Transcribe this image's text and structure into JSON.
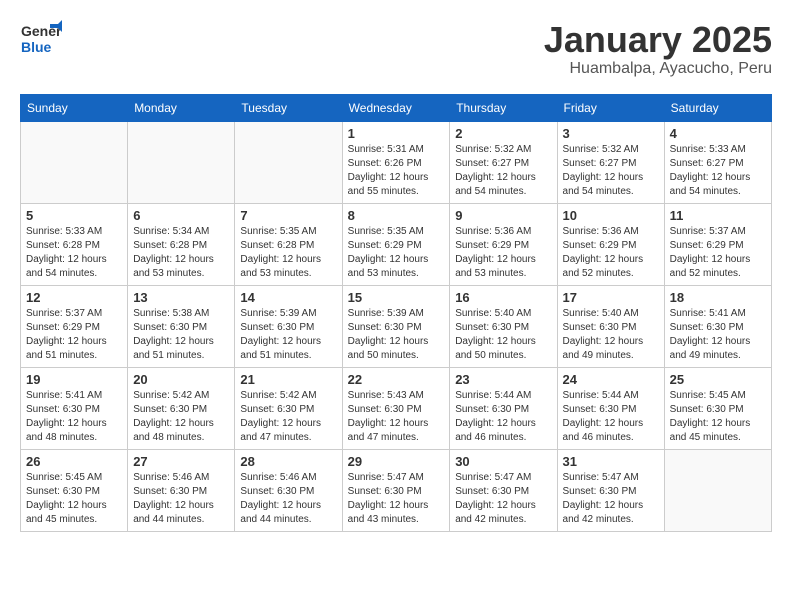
{
  "header": {
    "logo_general": "General",
    "logo_blue": "Blue",
    "month": "January 2025",
    "location": "Huambalpa, Ayacucho, Peru"
  },
  "weekdays": [
    "Sunday",
    "Monday",
    "Tuesday",
    "Wednesday",
    "Thursday",
    "Friday",
    "Saturday"
  ],
  "weeks": [
    [
      {
        "day": "",
        "info": ""
      },
      {
        "day": "",
        "info": ""
      },
      {
        "day": "",
        "info": ""
      },
      {
        "day": "1",
        "info": "Sunrise: 5:31 AM\nSunset: 6:26 PM\nDaylight: 12 hours\nand 55 minutes."
      },
      {
        "day": "2",
        "info": "Sunrise: 5:32 AM\nSunset: 6:27 PM\nDaylight: 12 hours\nand 54 minutes."
      },
      {
        "day": "3",
        "info": "Sunrise: 5:32 AM\nSunset: 6:27 PM\nDaylight: 12 hours\nand 54 minutes."
      },
      {
        "day": "4",
        "info": "Sunrise: 5:33 AM\nSunset: 6:27 PM\nDaylight: 12 hours\nand 54 minutes."
      }
    ],
    [
      {
        "day": "5",
        "info": "Sunrise: 5:33 AM\nSunset: 6:28 PM\nDaylight: 12 hours\nand 54 minutes."
      },
      {
        "day": "6",
        "info": "Sunrise: 5:34 AM\nSunset: 6:28 PM\nDaylight: 12 hours\nand 53 minutes."
      },
      {
        "day": "7",
        "info": "Sunrise: 5:35 AM\nSunset: 6:28 PM\nDaylight: 12 hours\nand 53 minutes."
      },
      {
        "day": "8",
        "info": "Sunrise: 5:35 AM\nSunset: 6:29 PM\nDaylight: 12 hours\nand 53 minutes."
      },
      {
        "day": "9",
        "info": "Sunrise: 5:36 AM\nSunset: 6:29 PM\nDaylight: 12 hours\nand 53 minutes."
      },
      {
        "day": "10",
        "info": "Sunrise: 5:36 AM\nSunset: 6:29 PM\nDaylight: 12 hours\nand 52 minutes."
      },
      {
        "day": "11",
        "info": "Sunrise: 5:37 AM\nSunset: 6:29 PM\nDaylight: 12 hours\nand 52 minutes."
      }
    ],
    [
      {
        "day": "12",
        "info": "Sunrise: 5:37 AM\nSunset: 6:29 PM\nDaylight: 12 hours\nand 51 minutes."
      },
      {
        "day": "13",
        "info": "Sunrise: 5:38 AM\nSunset: 6:30 PM\nDaylight: 12 hours\nand 51 minutes."
      },
      {
        "day": "14",
        "info": "Sunrise: 5:39 AM\nSunset: 6:30 PM\nDaylight: 12 hours\nand 51 minutes."
      },
      {
        "day": "15",
        "info": "Sunrise: 5:39 AM\nSunset: 6:30 PM\nDaylight: 12 hours\nand 50 minutes."
      },
      {
        "day": "16",
        "info": "Sunrise: 5:40 AM\nSunset: 6:30 PM\nDaylight: 12 hours\nand 50 minutes."
      },
      {
        "day": "17",
        "info": "Sunrise: 5:40 AM\nSunset: 6:30 PM\nDaylight: 12 hours\nand 49 minutes."
      },
      {
        "day": "18",
        "info": "Sunrise: 5:41 AM\nSunset: 6:30 PM\nDaylight: 12 hours\nand 49 minutes."
      }
    ],
    [
      {
        "day": "19",
        "info": "Sunrise: 5:41 AM\nSunset: 6:30 PM\nDaylight: 12 hours\nand 48 minutes."
      },
      {
        "day": "20",
        "info": "Sunrise: 5:42 AM\nSunset: 6:30 PM\nDaylight: 12 hours\nand 48 minutes."
      },
      {
        "day": "21",
        "info": "Sunrise: 5:42 AM\nSunset: 6:30 PM\nDaylight: 12 hours\nand 47 minutes."
      },
      {
        "day": "22",
        "info": "Sunrise: 5:43 AM\nSunset: 6:30 PM\nDaylight: 12 hours\nand 47 minutes."
      },
      {
        "day": "23",
        "info": "Sunrise: 5:44 AM\nSunset: 6:30 PM\nDaylight: 12 hours\nand 46 minutes."
      },
      {
        "day": "24",
        "info": "Sunrise: 5:44 AM\nSunset: 6:30 PM\nDaylight: 12 hours\nand 46 minutes."
      },
      {
        "day": "25",
        "info": "Sunrise: 5:45 AM\nSunset: 6:30 PM\nDaylight: 12 hours\nand 45 minutes."
      }
    ],
    [
      {
        "day": "26",
        "info": "Sunrise: 5:45 AM\nSunset: 6:30 PM\nDaylight: 12 hours\nand 45 minutes."
      },
      {
        "day": "27",
        "info": "Sunrise: 5:46 AM\nSunset: 6:30 PM\nDaylight: 12 hours\nand 44 minutes."
      },
      {
        "day": "28",
        "info": "Sunrise: 5:46 AM\nSunset: 6:30 PM\nDaylight: 12 hours\nand 44 minutes."
      },
      {
        "day": "29",
        "info": "Sunrise: 5:47 AM\nSunset: 6:30 PM\nDaylight: 12 hours\nand 43 minutes."
      },
      {
        "day": "30",
        "info": "Sunrise: 5:47 AM\nSunset: 6:30 PM\nDaylight: 12 hours\nand 42 minutes."
      },
      {
        "day": "31",
        "info": "Sunrise: 5:47 AM\nSunset: 6:30 PM\nDaylight: 12 hours\nand 42 minutes."
      },
      {
        "day": "",
        "info": ""
      }
    ]
  ]
}
